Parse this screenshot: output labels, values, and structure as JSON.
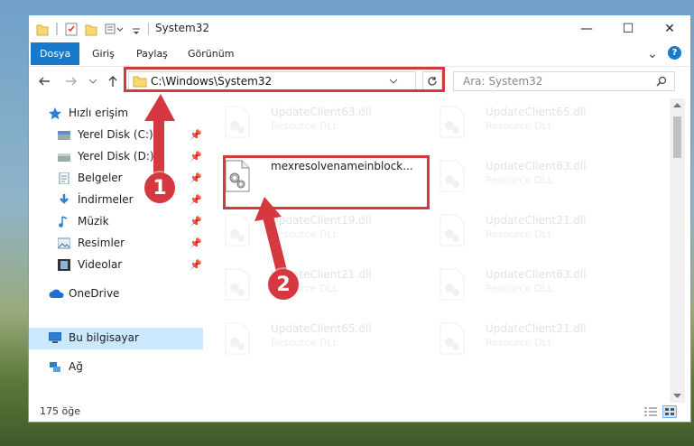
{
  "window": {
    "title": "System32",
    "minimize": "—",
    "maximize": "☐",
    "close": "✕"
  },
  "ribbon": {
    "tabs": [
      "Dosya",
      "Giriş",
      "Paylaş",
      "Görünüm"
    ],
    "expand": "⌄",
    "help": "?"
  },
  "address": {
    "path": "C:\\Windows\\System32"
  },
  "search": {
    "placeholder": "Ara: System32"
  },
  "sidebar": {
    "items": [
      {
        "label": "Hızlı erişim"
      },
      {
        "label": "Yerel Disk (C:)"
      },
      {
        "label": "Yerel Disk (D:)"
      },
      {
        "label": "Belgeler"
      },
      {
        "label": "İndirmeler"
      },
      {
        "label": "Müzik"
      },
      {
        "label": "Resimler"
      },
      {
        "label": "Videolar"
      },
      {
        "label": "OneDrive"
      },
      {
        "label": "Bu bilgisayar"
      },
      {
        "label": "Ağ"
      }
    ]
  },
  "files": [
    {
      "name": "UpdateClient63.dll",
      "type": "Resource DLL"
    },
    {
      "name": "UpdateClient65.dll",
      "type": "Resource DLL"
    },
    {
      "name": "mexresolvenameinblock...",
      "type": ""
    },
    {
      "name": "UpdateClient63.dll",
      "type": "Resource DLL"
    },
    {
      "name": "UpdateClient19.dll",
      "type": "Resource DLL"
    },
    {
      "name": "UpdateClient21.dll",
      "type": "Resource DLL"
    },
    {
      "name": "UpdateClient21.dll",
      "type": "Resource DLL"
    },
    {
      "name": "UpdateClient63.dll",
      "type": "Resource DLL"
    },
    {
      "name": "UpdateClient65.dll",
      "type": "Resource DLL"
    },
    {
      "name": "UpdateClient21.dll",
      "type": "Resource DLL"
    }
  ],
  "status": {
    "count": "175 öğe"
  },
  "annotations": {
    "step1": "1",
    "step2": "2",
    "color": "#d5383f"
  }
}
